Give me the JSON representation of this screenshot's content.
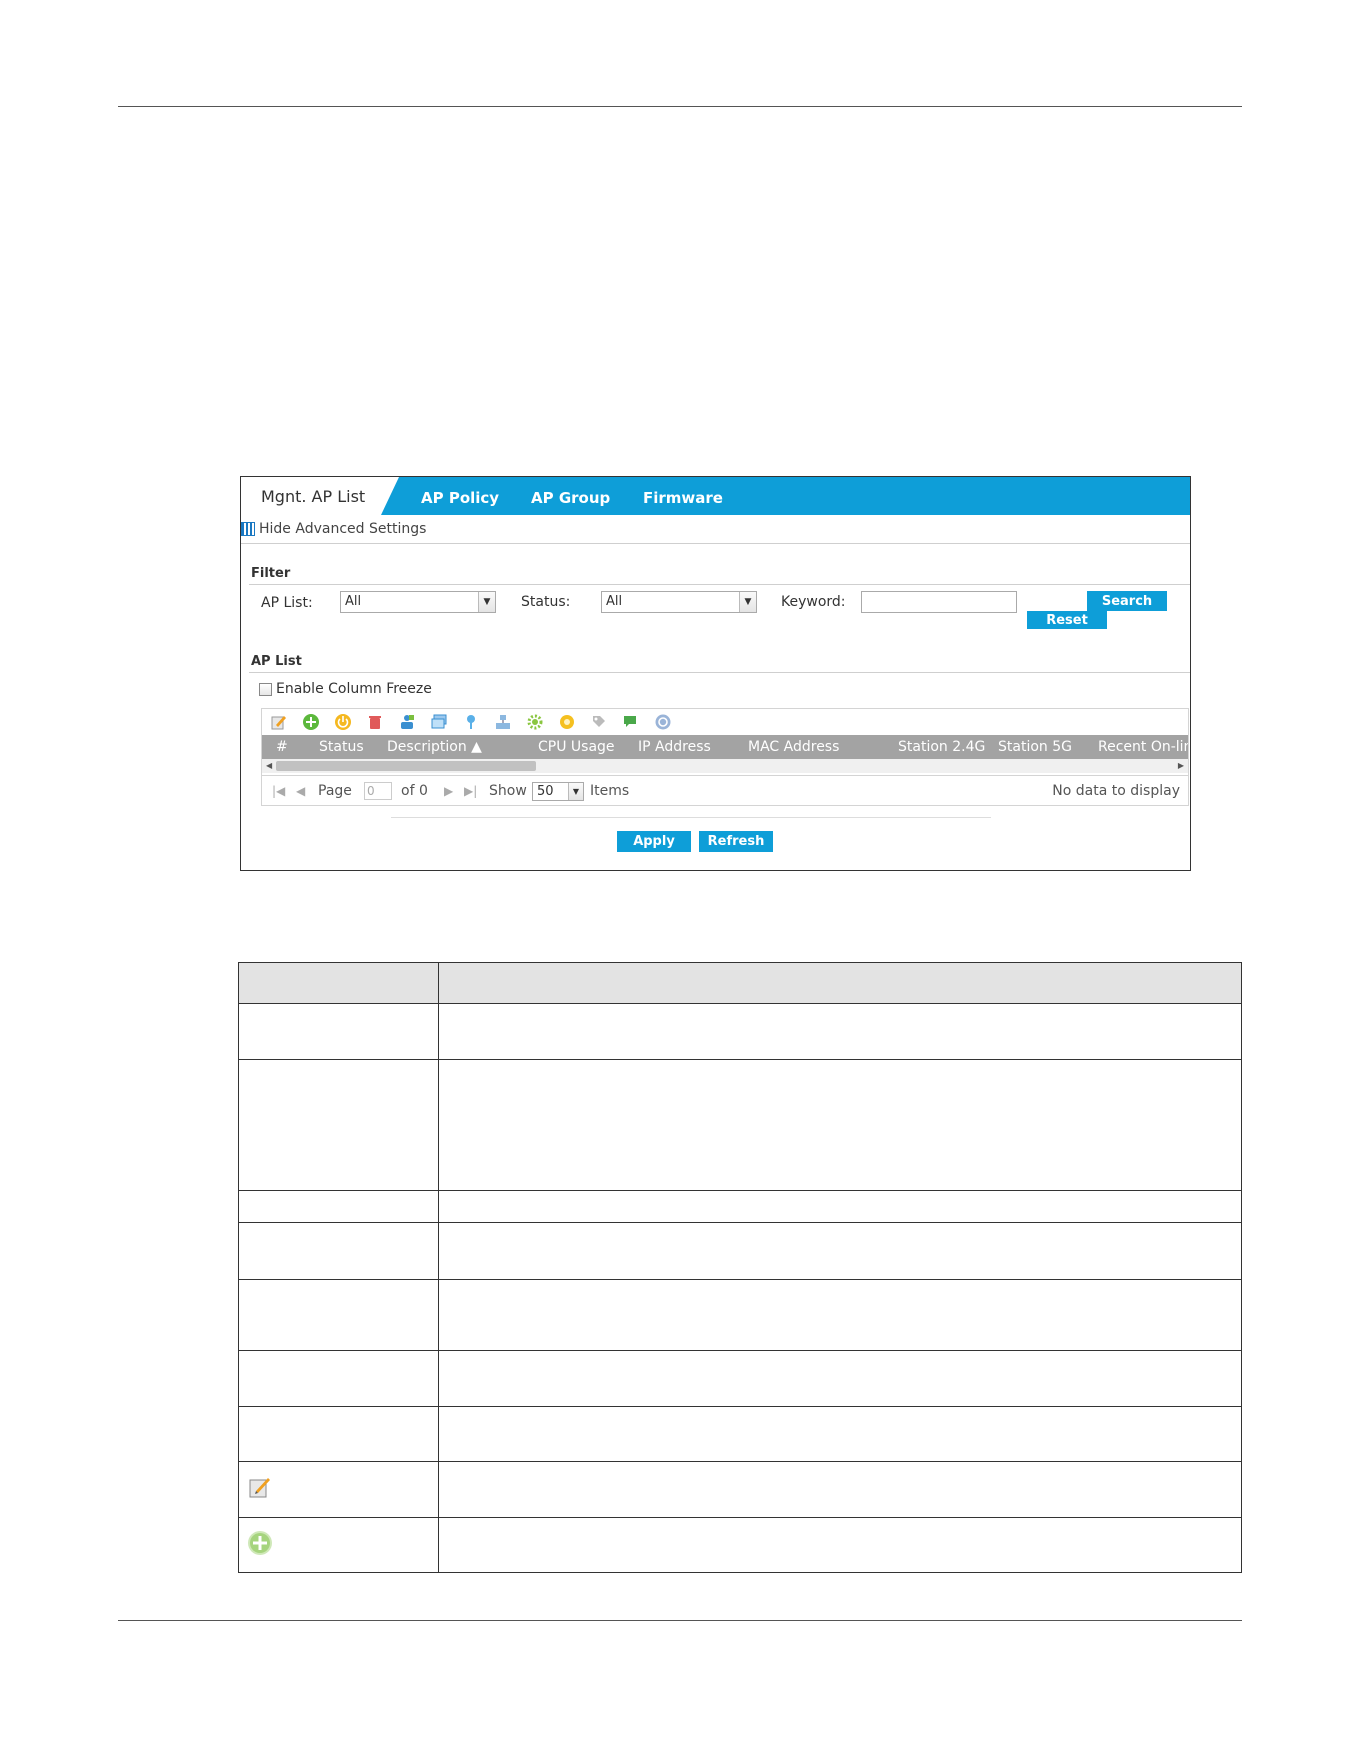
{
  "tabs": {
    "active": "Mgnt. AP List",
    "policy": "AP Policy",
    "group": "AP Group",
    "firmware": "Firmware"
  },
  "advanced_link": "Hide Advanced Settings",
  "filter": {
    "title": "Filter",
    "ap_list_label": "AP List:",
    "ap_list_value": "All",
    "status_label": "Status:",
    "status_value": "All",
    "keyword_label": "Keyword:",
    "keyword_value": "",
    "search_button": "Search",
    "reset_button": "Reset"
  },
  "ap_list": {
    "title": "AP List",
    "freeze_label": "Enable Column Freeze",
    "toolbar_icons": [
      "edit-icon",
      "add-icon",
      "power-icon",
      "delete-icon",
      "user-icon",
      "window-icon",
      "antenna-icon",
      "network-icon",
      "gear-icon",
      "coin-icon",
      "tag-icon",
      "chat-icon",
      "refresh-icon"
    ],
    "columns": [
      "#",
      "Status",
      "Description ▲",
      "CPU Usage",
      "IP Address",
      "MAC Address",
      "Station 2.4G",
      "Station 5G",
      "Recent On-lin"
    ],
    "pager": {
      "page_label": "Page",
      "page_value": "0",
      "of_label": "of 0",
      "show_label": "Show",
      "show_value": "50",
      "items_label": "Items",
      "empty_text": "No data to display"
    }
  },
  "footer_buttons": {
    "apply": "Apply",
    "refresh": "Refresh"
  },
  "description_table": {
    "row_icons": [
      "edit-icon",
      "add-icon"
    ]
  }
}
